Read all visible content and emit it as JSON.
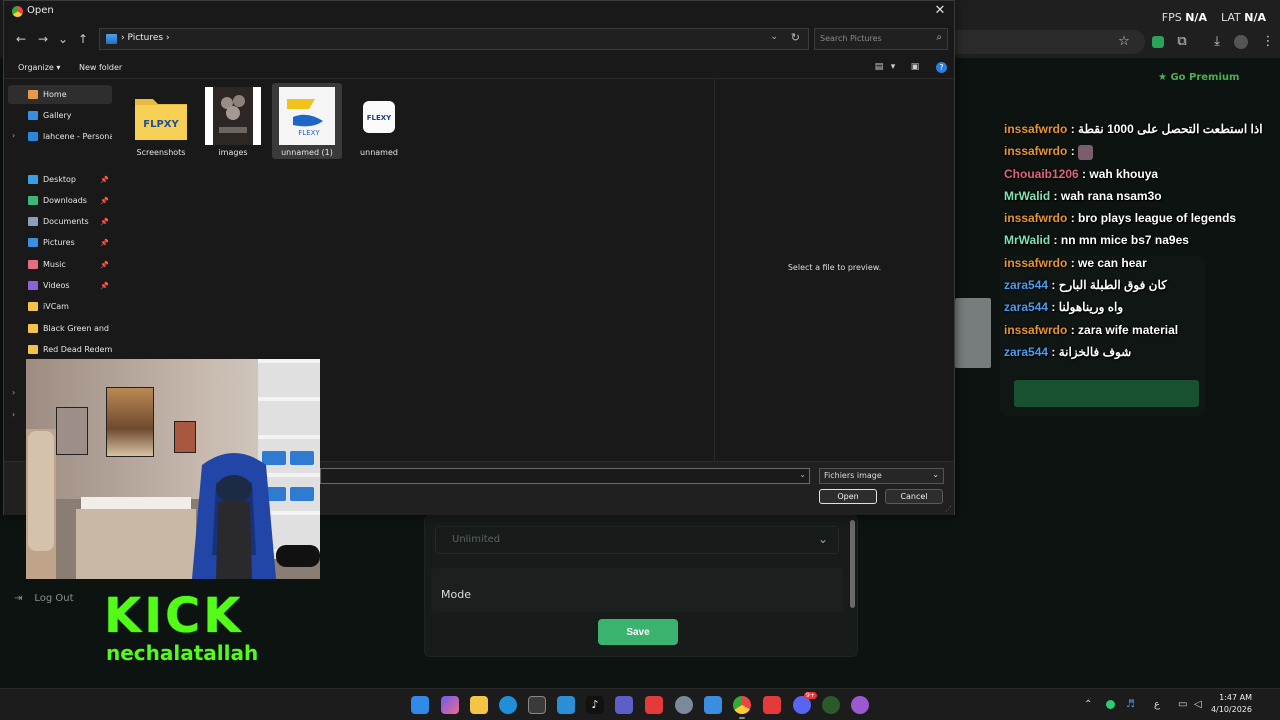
{
  "browser": {
    "stats": {
      "fps_label": "FPS",
      "fps_value": "N/A",
      "lat_label": "LAT",
      "lat_value": "N/A"
    },
    "go_premium": "Go Premium"
  },
  "page": {
    "unlimited_label": "Unlimited",
    "mode_label": "Mode",
    "save_label": "Save",
    "logout_label": "Log Out"
  },
  "chat": {
    "messages": [
      {
        "user": "inssafwrdo",
        "text": "اذا استطعت التحصل على 1000 نقطة",
        "color": "#e8962f"
      },
      {
        "user": "inssafwrdo",
        "text": "",
        "color": "#e8962f",
        "emote": true
      },
      {
        "user": "Chouaib1206",
        "text": "wah khouya",
        "color": "#e0637b"
      },
      {
        "user": "MrWalid",
        "text": "wah rana nsam3o",
        "color": "#7fe3b0"
      },
      {
        "user": "inssafwrdo",
        "text": "bro plays league of legends",
        "color": "#e8962f"
      },
      {
        "user": "MrWalid",
        "text": "nn mn mice bs7 na9es",
        "color": "#7fe3b0"
      },
      {
        "user": "inssafwrdo",
        "text": "we can hear",
        "color": "#e8962f"
      },
      {
        "user": "zara544",
        "text": "كان فوق الطبلة البارح",
        "color": "#4c9cf0"
      },
      {
        "user": "zara544",
        "text": "واه وريناهولنا",
        "color": "#4c9cf0"
      },
      {
        "user": "inssafwrdo",
        "text": "zara wife material",
        "color": "#e8962f"
      },
      {
        "user": "zara544",
        "text": "شوف فالخزانة",
        "color": "#4c9cf0"
      }
    ]
  },
  "dialog": {
    "title": "Open",
    "path_segment": "Pictures",
    "search_placeholder": "Search Pictures",
    "organize_label": "Organize",
    "new_folder_label": "New folder",
    "preview_text": "Select a file to preview.",
    "filetype_value": "Fichiers image",
    "open_label": "Open",
    "cancel_label": "Cancel",
    "nav": [
      {
        "label": "Home",
        "icon": "home-icon",
        "color": "#e79a4a",
        "selected": true
      },
      {
        "label": "Gallery",
        "icon": "gallery-icon",
        "color": "#3b8de0"
      },
      {
        "label": "lahcene - Personal",
        "icon": "onedrive-icon",
        "color": "#2b86e0"
      },
      {
        "label": "Desktop",
        "icon": "desktop-icon",
        "color": "#3aa0e6",
        "pinned": true
      },
      {
        "label": "Downloads",
        "icon": "download-icon",
        "color": "#3fb57b",
        "pinned": true
      },
      {
        "label": "Documents",
        "icon": "documents-icon",
        "color": "#8aa0b8",
        "pinned": true
      },
      {
        "label": "Pictures",
        "icon": "pictures-icon",
        "color": "#3a8fe3",
        "pinned": true
      },
      {
        "label": "Music",
        "icon": "music-icon",
        "color": "#e86c7e",
        "pinned": true
      },
      {
        "label": "Videos",
        "icon": "videos-icon",
        "color": "#8a63d8",
        "pinned": true
      },
      {
        "label": "iVCam",
        "icon": "folder-icon",
        "color": "#f2c14e"
      },
      {
        "label": "Black Green and Wh",
        "icon": "folder-icon",
        "color": "#f2c14e"
      },
      {
        "label": "Red Dead Redempt",
        "icon": "folder-icon",
        "color": "#f2c14e"
      }
    ],
    "files": [
      {
        "name": "Screenshots",
        "kind": "folder-icon"
      },
      {
        "name": "images",
        "kind": "image-thumbnail"
      },
      {
        "name": "unnamed (1)",
        "kind": "image-thumbnail",
        "selected": true
      },
      {
        "name": "unnamed",
        "kind": "image-thumbnail"
      }
    ]
  },
  "overlay": {
    "kick_wordmark": "KICK",
    "kick_handle": "nechalatallah",
    "kick_color": "#53fc18"
  },
  "taskbar": {
    "time": "1:47 AM",
    "date": "4/10/2026",
    "lang": "ع",
    "discord_badge": "9+"
  }
}
